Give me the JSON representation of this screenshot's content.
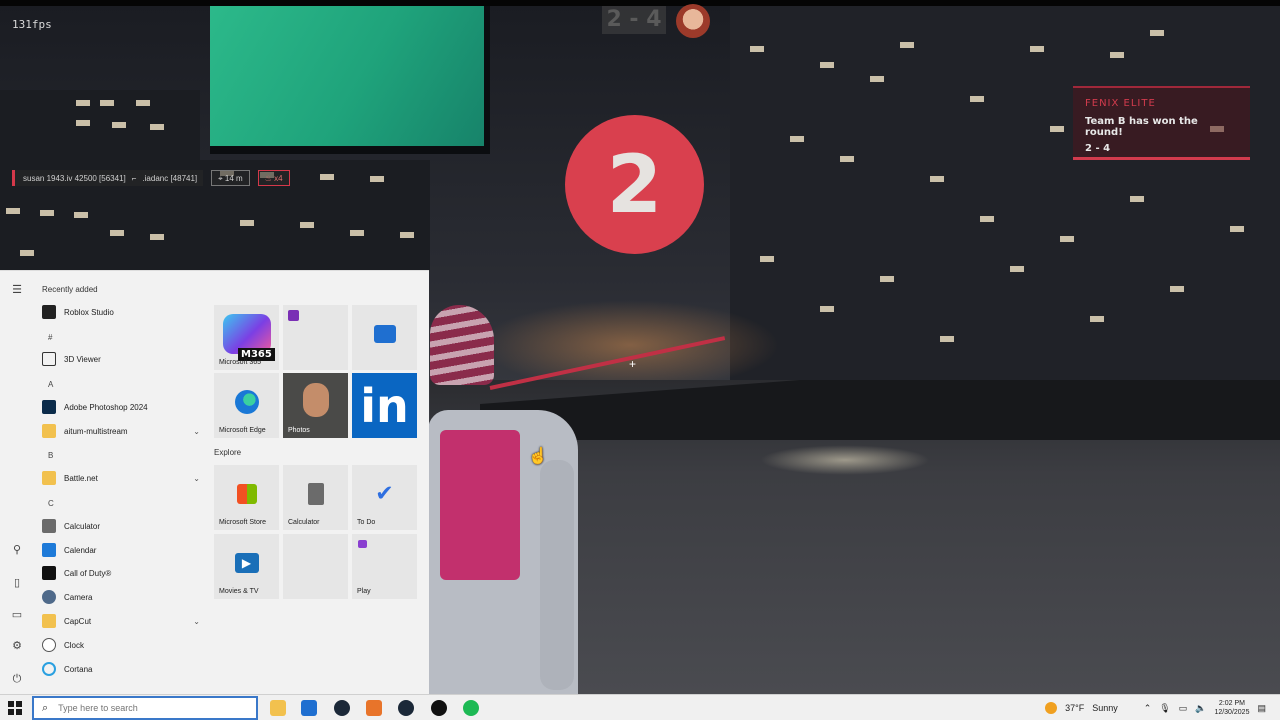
{
  "hud": {
    "fps": "131fps",
    "score": "2 - 4",
    "countdown": "2",
    "killfeed": {
      "killer": "susan 1943.iv 42500 [56341]",
      "weapon_icon": "pistol-icon",
      "victim": ".iadanc [48741]",
      "distance": "14 m",
      "streak": "x4"
    },
    "notification": {
      "title": "FENIX ELITE",
      "message": "Team B has won the round!",
      "score": "2 - 4"
    }
  },
  "start_menu": {
    "recently_added_label": "Recently added",
    "explore_label": "Explore",
    "sections": {
      "hash": "#",
      "a": "A",
      "b": "B",
      "c": "C"
    },
    "apps": {
      "roblox": "Roblox Studio",
      "viewer3d": "3D Viewer",
      "photoshop": "Adobe Photoshop 2024",
      "aitum": "aitum-multistream",
      "battlenet": "Battle.net",
      "calculator": "Calculator",
      "calendar": "Calendar",
      "cod": "Call of Duty®",
      "camera": "Camera",
      "capcut": "CapCut",
      "clock": "Clock",
      "cortana": "Cortana"
    },
    "tiles": {
      "m365_badge": "M365",
      "m365": "Microsoft 365",
      "edge": "Microsoft Edge",
      "photos": "Photos",
      "store": "Microsoft Store",
      "calculator": "Calculator",
      "todo": "To Do",
      "movies": "Movies & TV",
      "play": "Play",
      "linkedin": "in"
    }
  },
  "taskbar": {
    "search_placeholder": "Type here to search",
    "weather_temp": "37°F",
    "weather_cond": "Sunny",
    "time": "2:02 PM",
    "date": "12/30/2025"
  },
  "colors": {
    "accent_red": "#d9404e",
    "search_border": "#3a78c9",
    "billboard": "#1fa37b"
  }
}
